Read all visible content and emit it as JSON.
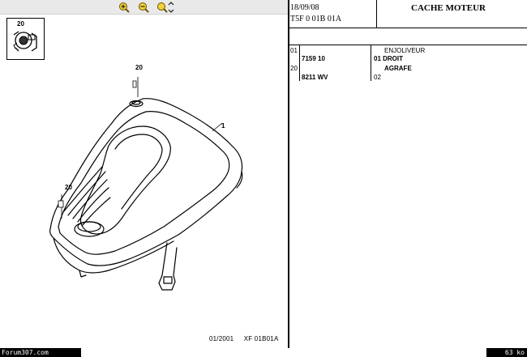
{
  "header": {
    "date": "18/09/08",
    "reference": "T5F 0 01B 01A",
    "title": "CACHE MOTEUR"
  },
  "parts": [
    {
      "item": "01",
      "part_number": "7159 10",
      "designation_line1": "ENJOLIVEUR",
      "designation_line2": "01 DROIT"
    },
    {
      "item": "20",
      "part_number": "8211 WV",
      "designation_line1": "AGRAFE",
      "designation_line2": "02"
    }
  ],
  "drawing": {
    "thumbnail_number": "20",
    "callouts": [
      "20",
      "1",
      "20"
    ],
    "footer_date": "01/2001",
    "footer_ref": "XF 01B01A"
  },
  "toolbar": {
    "icons": [
      "zoom-in-icon",
      "zoom-out-icon",
      "zoom-fit-icon"
    ]
  },
  "status": {
    "site": "Forum307.com",
    "size": "63 ko"
  }
}
